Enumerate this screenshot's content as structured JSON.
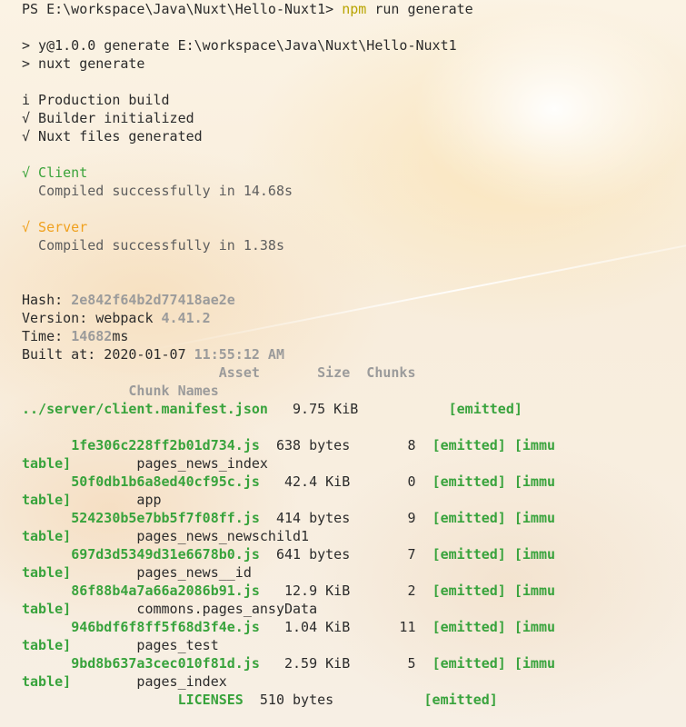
{
  "prompt": {
    "ps": "PS E:\\workspace\\Java\\Nuxt\\Hello-Nuxt1> ",
    "npm": "npm",
    "rest": " run generate"
  },
  "run": {
    "line1": "> y@1.0.0 generate E:\\workspace\\Java\\Nuxt\\Hello-Nuxt1",
    "line2": "> nuxt generate"
  },
  "build": {
    "info": "i Production build",
    "builder": "√ Builder initialized",
    "files": "√ Nuxt files generated"
  },
  "client": {
    "label": "√ Client",
    "msg": "  Compiled successfully in 14.68s"
  },
  "server": {
    "label": "√ Server",
    "msg": "  Compiled successfully in 1.38s"
  },
  "stats": {
    "hash_label": "Hash: ",
    "hash": "2e842f64b2d77418ae2e",
    "version_label": "Version: webpack ",
    "version": "4.41.2",
    "time_label": "Time: ",
    "time": "14682",
    "time_unit": "ms",
    "built_label": "Built at: 2020-01-07 ",
    "built_time": "11:55:12 AM"
  },
  "table": {
    "header1": "                        Asset       Size  Chunks",
    "header2": "             Chunk Names",
    "manifest_name": "../server/client.manifest.json",
    "manifest_size": "   9.75 KiB           ",
    "manifest_status": "[emitted]",
    "rows": [
      {
        "pad": "      ",
        "name": "1fe306c228ff2b01d734.js",
        "mid": "  638 bytes       8  ",
        "status": "[emitted] [immu",
        "wrap": "table]",
        "chunk": "        pages_news_index"
      },
      {
        "pad": "      ",
        "name": "50f0db1b6a8ed40cf95c.js",
        "mid": "   42.4 KiB       0  ",
        "status": "[emitted] [immu",
        "wrap": "table]",
        "chunk": "        app"
      },
      {
        "pad": "      ",
        "name": "524230b5e7bb5f7f08ff.js",
        "mid": "  414 bytes       9  ",
        "status": "[emitted] [immu",
        "wrap": "table]",
        "chunk": "        pages_news_newschild1"
      },
      {
        "pad": "      ",
        "name": "697d3d5349d31e6678b0.js",
        "mid": "  641 bytes       7  ",
        "status": "[emitted] [immu",
        "wrap": "table]",
        "chunk": "        pages_news__id"
      },
      {
        "pad": "      ",
        "name": "86f88b4a7a66a2086b91.js",
        "mid": "   12.9 KiB       2  ",
        "status": "[emitted] [immu",
        "wrap": "table]",
        "chunk": "        commons.pages_ansyData"
      },
      {
        "pad": "      ",
        "name": "946bdf6f8ff5f68d3f4e.js",
        "mid": "   1.04 KiB      11  ",
        "status": "[emitted] [immu",
        "wrap": "table]",
        "chunk": "        pages_test"
      },
      {
        "pad": "      ",
        "name": "9bd8b637a3cec010f81d.js",
        "mid": "   2.59 KiB       5  ",
        "status": "[emitted] [immu",
        "wrap": "table]",
        "chunk": "        pages_index"
      }
    ],
    "licenses_pad": "                   ",
    "licenses_name": "LICENSES",
    "licenses_size": "  510 bytes           ",
    "licenses_status": "[emitted]"
  }
}
